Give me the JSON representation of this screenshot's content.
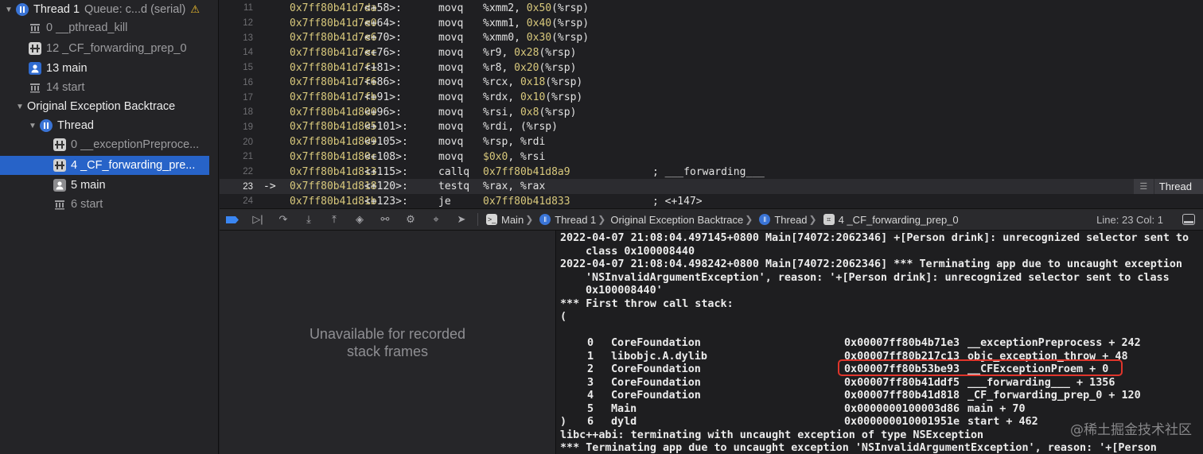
{
  "navigator": {
    "items": [
      {
        "label": "Thread 1",
        "queue": "Queue: c...d (serial)",
        "icon": "thread-icon",
        "warning": "⚠"
      },
      {
        "label": "0 __pthread_kill",
        "icon": "library-icon"
      },
      {
        "label": "12 _CF_forwarding_prep_0",
        "icon": "stack-frame-icon"
      },
      {
        "label": "13 main",
        "icon": "user-code-icon"
      },
      {
        "label": "14 start",
        "icon": "library-icon"
      },
      {
        "label": "Original Exception Backtrace"
      },
      {
        "label": "Thread",
        "icon": "thread-icon"
      },
      {
        "label": "0 __exceptionPreproce...",
        "icon": "stack-frame-icon"
      },
      {
        "label": "4 _CF_forwarding_pre...",
        "icon": "stack-frame-icon",
        "selected": true
      },
      {
        "label": "5 main",
        "icon": "user-code-icon"
      },
      {
        "label": "6 start",
        "icon": "library-icon"
      }
    ]
  },
  "assembly": {
    "rows": [
      {
        "line": "11",
        "addr": "0x7ff80b41d7da",
        "off": "<+58>:",
        "mnemonic": "movq",
        "ops": [
          "%xmm2, ",
          "0x50",
          "(%rsp)"
        ]
      },
      {
        "line": "12",
        "addr": "0x7ff80b41d7e0",
        "off": "<+64>:",
        "mnemonic": "movq",
        "ops": [
          "%xmm1, ",
          "0x40",
          "(%rsp)"
        ]
      },
      {
        "line": "13",
        "addr": "0x7ff80b41d7e6",
        "off": "<+70>:",
        "mnemonic": "movq",
        "ops": [
          "%xmm0, ",
          "0x30",
          "(%rsp)"
        ]
      },
      {
        "line": "14",
        "addr": "0x7ff80b41d7ec",
        "off": "<+76>:",
        "mnemonic": "movq",
        "ops": [
          "%r9, ",
          "0x28",
          "(%rsp)"
        ]
      },
      {
        "line": "15",
        "addr": "0x7ff80b41d7f1",
        "off": "<+81>:",
        "mnemonic": "movq",
        "ops": [
          "%r8, ",
          "0x20",
          "(%rsp)"
        ]
      },
      {
        "line": "16",
        "addr": "0x7ff80b41d7f6",
        "off": "<+86>:",
        "mnemonic": "movq",
        "ops": [
          "%rcx, ",
          "0x18",
          "(%rsp)"
        ]
      },
      {
        "line": "17",
        "addr": "0x7ff80b41d7fb",
        "off": "<+91>:",
        "mnemonic": "movq",
        "ops": [
          "%rdx, ",
          "0x10",
          "(%rsp)"
        ]
      },
      {
        "line": "18",
        "addr": "0x7ff80b41d800",
        "off": "<+96>:",
        "mnemonic": "movq",
        "ops": [
          "%rsi, ",
          "0x8",
          "(%rsp)"
        ]
      },
      {
        "line": "19",
        "addr": "0x7ff80b41d805",
        "off": "<+101>:",
        "mnemonic": "movq",
        "ops": [
          "%rdi, (%rsp)",
          "",
          ""
        ]
      },
      {
        "line": "20",
        "addr": "0x7ff80b41d809",
        "off": "<+105>:",
        "mnemonic": "movq",
        "ops": [
          "%rsp, %rdi",
          "",
          ""
        ]
      },
      {
        "line": "21",
        "addr": "0x7ff80b41d80c",
        "off": "<+108>:",
        "mnemonic": "movq",
        "ops": [
          "",
          "$0x0",
          ", %rsi"
        ]
      },
      {
        "line": "22",
        "addr": "0x7ff80b41d813",
        "off": "<+115>:",
        "mnemonic": "callq",
        "ops": [
          "",
          "0x7ff80b41d8a9",
          ""
        ],
        "comment": "; ___forwarding___"
      },
      {
        "line": "23",
        "addr": "0x7ff80b41d818",
        "off": "<+120>:",
        "mnemonic": "testq",
        "ops": [
          "%rax, %rax",
          "",
          ""
        ],
        "current": true,
        "arrow": "->"
      },
      {
        "line": "24",
        "addr": "0x7ff80b41d81b",
        "off": "<+123>:",
        "mnemonic": "je",
        "ops": [
          "",
          "0x7ff80b41d833",
          ""
        ],
        "comment": "; <+147>"
      }
    ],
    "thread_badge": "Thread"
  },
  "debug_bar": {
    "breadcrumbs": [
      "Main",
      "Thread 1",
      "Original Exception Backtrace",
      "Thread",
      "4 _CF_forwarding_prep_0"
    ],
    "line_col": "Line: 23  Col: 1"
  },
  "variables": {
    "placeholder": "Unavailable for recorded\nstack frames"
  },
  "console": {
    "lines_top": [
      {
        "text": "2022-04-07 21:08:04.497145+0800 Main[74072:2062346] +[Person drink]: unrecognized selector sent to",
        "indent": false
      },
      {
        "text": "class 0x100008440",
        "indent": true
      },
      {
        "text": "2022-04-07 21:08:04.498242+0800 Main[74072:2062346] *** Terminating app due to uncaught exception",
        "indent": false
      },
      {
        "text": "'NSInvalidArgumentException', reason: '+[Person drink]: unrecognized selector sent to class",
        "indent": true
      },
      {
        "text": "0x100008440'",
        "indent": true
      },
      {
        "text": "*** First throw call stack:",
        "indent": false
      },
      {
        "text": "(",
        "indent": false
      }
    ],
    "frames": [
      {
        "index": "0",
        "library": "CoreFoundation",
        "address": "0x00007ff80b4b71e3",
        "symbol": "__exceptionPreprocess + 242"
      },
      {
        "index": "1",
        "library": "libobjc.A.dylib",
        "address": "0x00007ff80b217c13",
        "symbol": "objc_exception_throw + 48"
      },
      {
        "index": "2",
        "library": "CoreFoundation",
        "address": "0x00007ff80b53be93",
        "symbol": "__CFExceptionProem + 0"
      },
      {
        "index": "3",
        "library": "CoreFoundation",
        "address": "0x00007ff80b41ddf5",
        "symbol": "___forwarding___ + 1356"
      },
      {
        "index": "4",
        "library": "CoreFoundation",
        "address": "0x00007ff80b41d818",
        "symbol": "_CF_forwarding_prep_0 + 120"
      },
      {
        "index": "5",
        "library": "Main",
        "address": "0x0000000100003d86",
        "symbol": "main + 70"
      },
      {
        "index": "6",
        "library": "dyld",
        "address": "0x000000010001951e",
        "symbol": "start + 462"
      }
    ],
    "lines_bottom": [
      {
        "text": ")"
      },
      {
        "text": "libc++abi: terminating with uncaught exception of type NSException"
      },
      {
        "text": "*** Terminating app due to uncaught exception 'NSInvalidArgumentException', reason: '+[Person"
      }
    ],
    "watermark": "@稀土掘金技术社区"
  },
  "colors": {
    "selection": "#2763c8",
    "highlight_box": "#e0352b",
    "address": "#d9c97c"
  }
}
